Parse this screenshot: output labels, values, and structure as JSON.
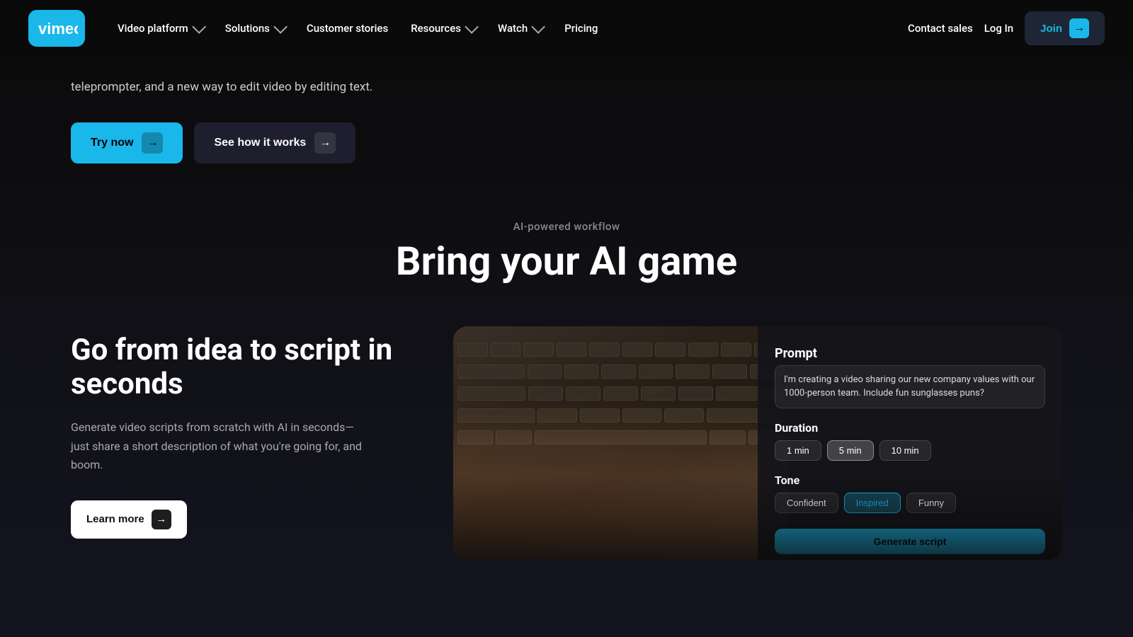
{
  "nav": {
    "logo_alt": "Vimeo",
    "links": [
      {
        "label": "Video platform",
        "has_dropdown": true
      },
      {
        "label": "Solutions",
        "has_dropdown": true
      },
      {
        "label": "Customer stories",
        "has_dropdown": false
      },
      {
        "label": "Resources",
        "has_dropdown": true
      },
      {
        "label": "Watch",
        "has_dropdown": true
      },
      {
        "label": "Pricing",
        "has_dropdown": false
      }
    ],
    "contact_label": "Contact sales",
    "login_label": "Log In",
    "join_label": "Join"
  },
  "hero": {
    "description": "teleprompter, and a new way to edit video by editing text.",
    "try_now_label": "Try now",
    "see_how_label": "See how it works"
  },
  "ai_section": {
    "label": "AI-powered workflow",
    "heading": "Bring your AI game"
  },
  "feature": {
    "title": "Go from idea to script in seconds",
    "description": "Generate video scripts from scratch with AI in seconds—just share a short description of what you're going for, and boom.",
    "learn_more_label": "Learn more",
    "card": {
      "prompt_title": "Prompt",
      "prompt_text": "I'm creating a video sharing our new company values with our 1000-person team. Include fun sunglasses puns?",
      "duration_label": "Duration",
      "duration_options": [
        "1 min",
        "5 min",
        "10 min"
      ],
      "duration_active": "5 min",
      "tone_label": "Tone",
      "tone_options": [
        "Confident",
        "Inspired",
        "Funny"
      ],
      "tone_active": "Inspired",
      "generate_label": "Generate script"
    }
  }
}
